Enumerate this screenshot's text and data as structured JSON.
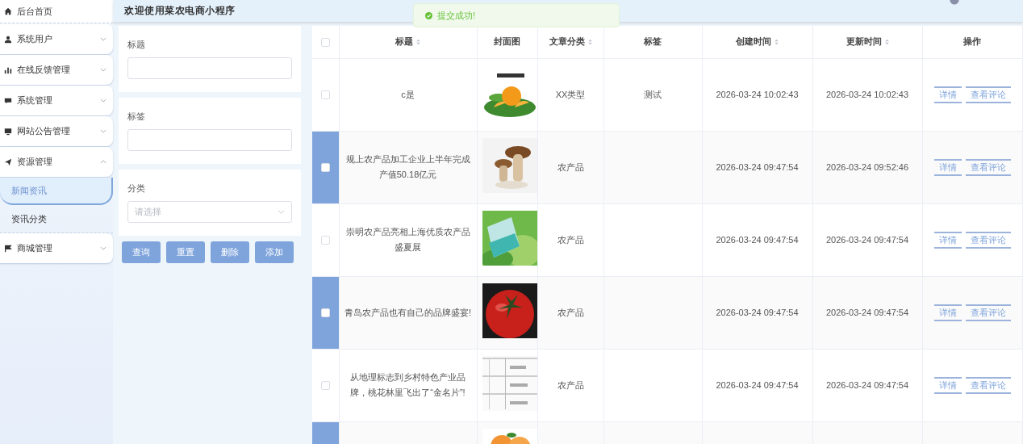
{
  "sidebar": {
    "items": [
      {
        "label": "后台首页",
        "kind": "link"
      },
      {
        "label": "系统用户",
        "kind": "menu",
        "expanded": false
      },
      {
        "label": "在线反馈管理",
        "kind": "menu",
        "expanded": false
      },
      {
        "label": "系统管理",
        "kind": "menu",
        "expanded": false
      },
      {
        "label": "网站公告管理",
        "kind": "menu",
        "expanded": false
      },
      {
        "label": "资源管理",
        "kind": "menu",
        "expanded": true,
        "children": [
          {
            "label": "新闻资讯",
            "selected": true
          },
          {
            "label": "资讯分类",
            "selected": false
          }
        ]
      },
      {
        "label": "商城管理",
        "kind": "menu",
        "expanded": false
      }
    ]
  },
  "header": {
    "title": "欢迎使用菜农电商小程序"
  },
  "toast": {
    "message": "提交成功!"
  },
  "filters": {
    "fields": [
      {
        "label": "标题",
        "kind": "text"
      },
      {
        "label": "标签",
        "kind": "text"
      },
      {
        "label": "分类",
        "kind": "select",
        "placeholder": "请选择"
      }
    ],
    "buttons": [
      "查询",
      "重置",
      "删除",
      "添加"
    ]
  },
  "table": {
    "all_checked": false,
    "columns": [
      {
        "label": "标题",
        "sortable": true
      },
      {
        "label": "封面图",
        "sortable": false
      },
      {
        "label": "文章分类",
        "sortable": true
      },
      {
        "label": "标签",
        "sortable": false
      },
      {
        "label": "创建时间",
        "sortable": true
      },
      {
        "label": "更新时间",
        "sortable": true
      },
      {
        "label": "操作",
        "sortable": false
      }
    ],
    "rows": [
      {
        "highlighted": false,
        "checked": false,
        "title": "c是",
        "cover": {
          "kind": "picture"
        },
        "category": "XX类型",
        "tag": "测试",
        "created": "2026-03-24 10:02:43",
        "updated": "2026-03-24 10:02:43",
        "actions": [
          "详情",
          "查看评论"
        ]
      },
      {
        "highlighted": true,
        "checked": false,
        "title": "规上农产品加工企业上半年完成产值50.18亿元",
        "cover": {
          "kind": "picture"
        },
        "category": "农产品",
        "created": "2026-03-24 09:47:54",
        "updated": "2026-03-24 09:52:46",
        "actions": [
          "详情",
          "查看评论"
        ]
      },
      {
        "highlighted": false,
        "checked": false,
        "title": "崇明农产品亮相上海优质农产品盛夏展",
        "cover": {
          "kind": "picture"
        },
        "category": "农产品",
        "created": "2026-03-24 09:47:54",
        "updated": "2026-03-24 09:47:54",
        "actions": [
          "详情",
          "查看评论"
        ]
      },
      {
        "highlighted": true,
        "checked": false,
        "title": "青岛农产品也有自己的品牌盛宴!",
        "cover": {
          "kind": "picture"
        },
        "category": "农产品",
        "created": "2026-03-24 09:47:54",
        "updated": "2026-03-24 09:47:54",
        "actions": [
          "详情",
          "查看评论"
        ]
      },
      {
        "highlighted": false,
        "checked": false,
        "title": "从地理标志到乡村特色产业品牌，桃花林里飞出了“金名片”!",
        "cover": {
          "kind": "picture"
        },
        "category": "农产品",
        "created": "2026-03-24 09:47:54",
        "updated": "2026-03-24 09:47:54",
        "actions": [
          "详情",
          "查看评论"
        ]
      },
      {
        "highlighted": true,
        "cover": {
          "kind": "picture"
        }
      }
    ]
  }
}
